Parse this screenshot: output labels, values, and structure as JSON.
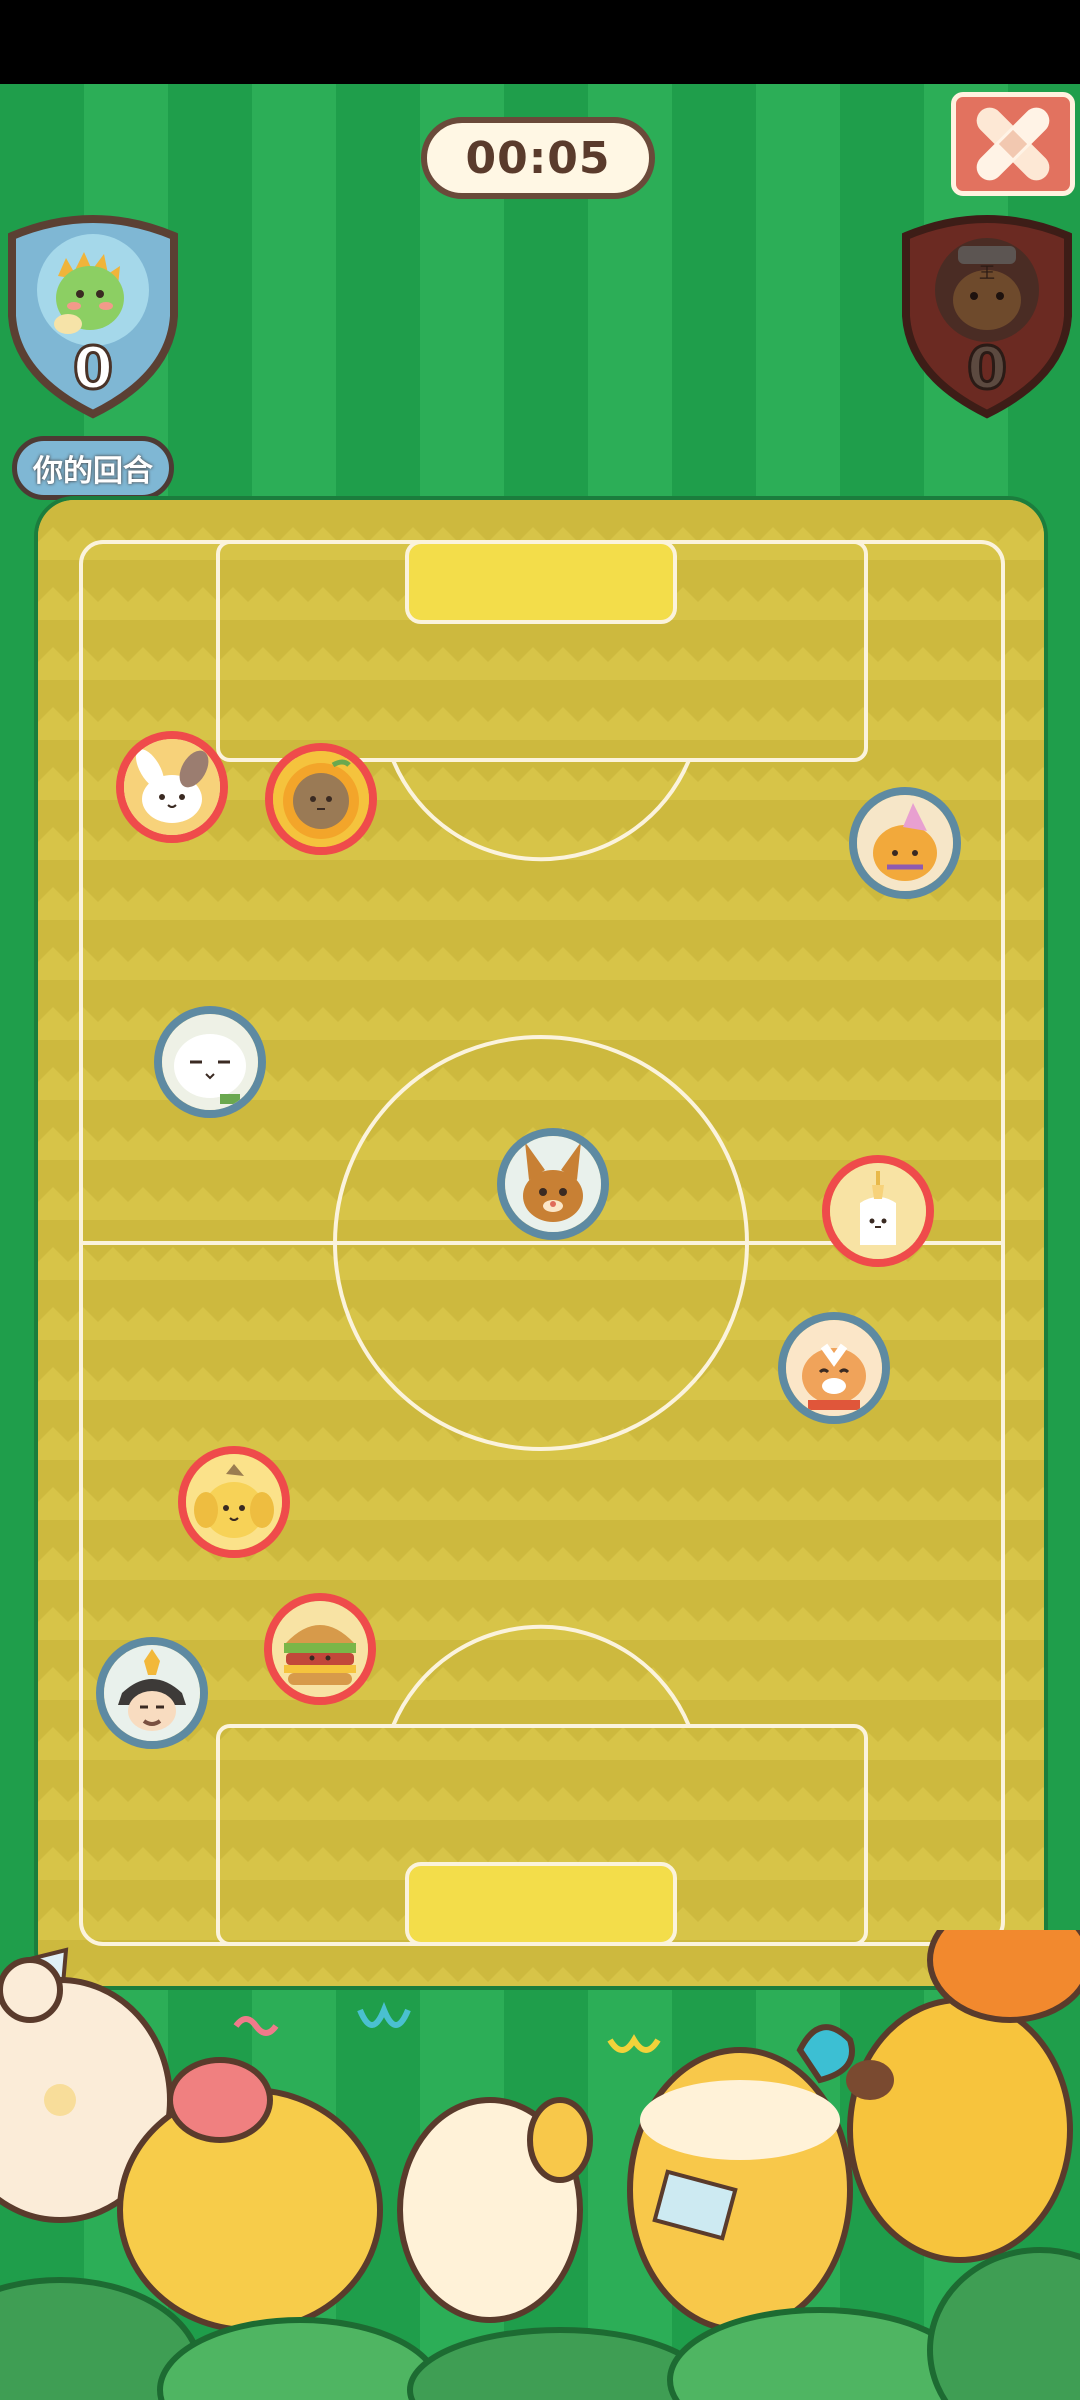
{
  "match": {
    "timer": "00:05",
    "turn_label": "你的回合"
  },
  "home": {
    "score": "0",
    "avatar": "green-dino-avatar-icon",
    "color": "#7fb7d4"
  },
  "away": {
    "score": "0",
    "avatar": "dark-bear-avatar-icon",
    "color": "#6b2a22"
  },
  "colors": {
    "grass_light": "#2cae57",
    "grass_dark": "#1f9e4b",
    "pitch": "#cdb93e",
    "goal": "#f3dd4a",
    "red_team": "#ef4b4b",
    "blue_team": "#5e8aa2"
  },
  "players": [
    {
      "team": "red",
      "icon": "bunny-icon"
    },
    {
      "team": "red",
      "icon": "sunflower-icon"
    },
    {
      "team": "blue",
      "icon": "party-bear-icon"
    },
    {
      "team": "blue",
      "icon": "white-cat-icon"
    },
    {
      "team": "blue",
      "icon": "bunny-jaguar-icon"
    },
    {
      "team": "red",
      "icon": "glue-bottle-icon"
    },
    {
      "team": "blue",
      "icon": "tiger-icon"
    },
    {
      "team": "red",
      "icon": "yellow-pup-icon"
    },
    {
      "team": "red",
      "icon": "burger-icon"
    },
    {
      "team": "blue",
      "icon": "samurai-icon"
    }
  ]
}
